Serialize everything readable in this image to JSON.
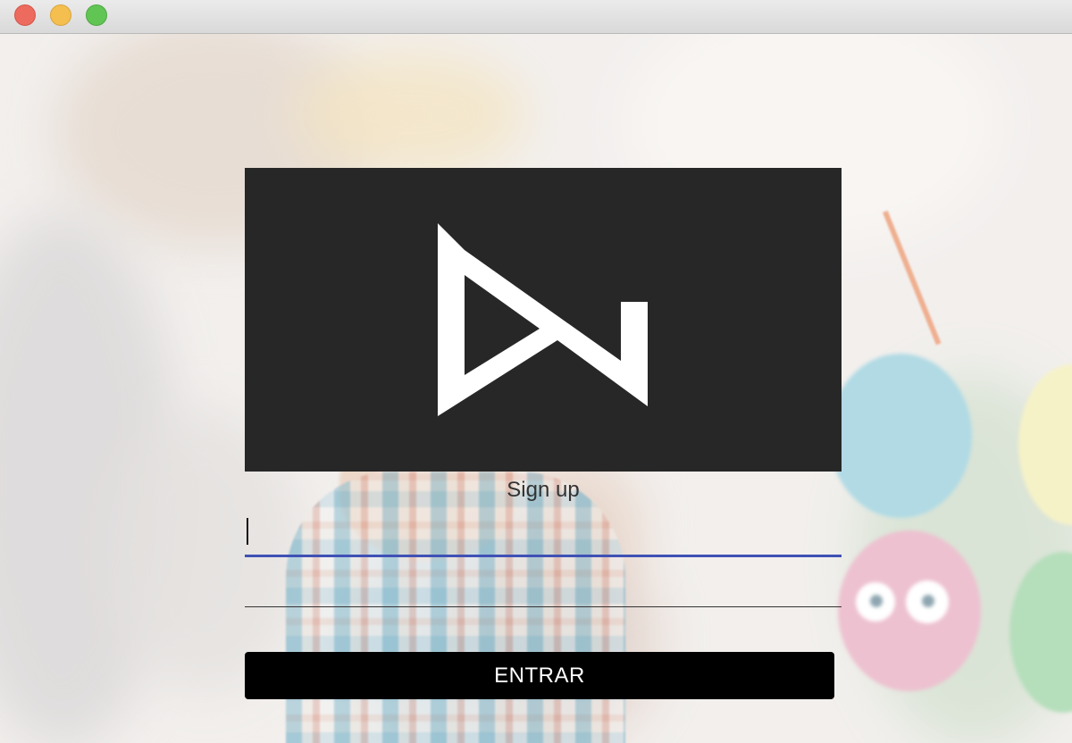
{
  "window": {
    "controls": [
      "close",
      "minimize",
      "zoom"
    ],
    "colors": {
      "close": "#ec6a5e",
      "minimize": "#f4bf4f",
      "zoom": "#61c554"
    }
  },
  "logo": {
    "icon": "play-n-logo-icon",
    "panel_color": "#272727",
    "mark_color": "#ffffff"
  },
  "form": {
    "heading": "Sign up",
    "fields": [
      {
        "value": "",
        "placeholder": "",
        "focused": true,
        "accent": "#3f51b5"
      },
      {
        "value": "",
        "placeholder": "",
        "focused": false
      }
    ],
    "submit_label": "ENTRAR"
  }
}
